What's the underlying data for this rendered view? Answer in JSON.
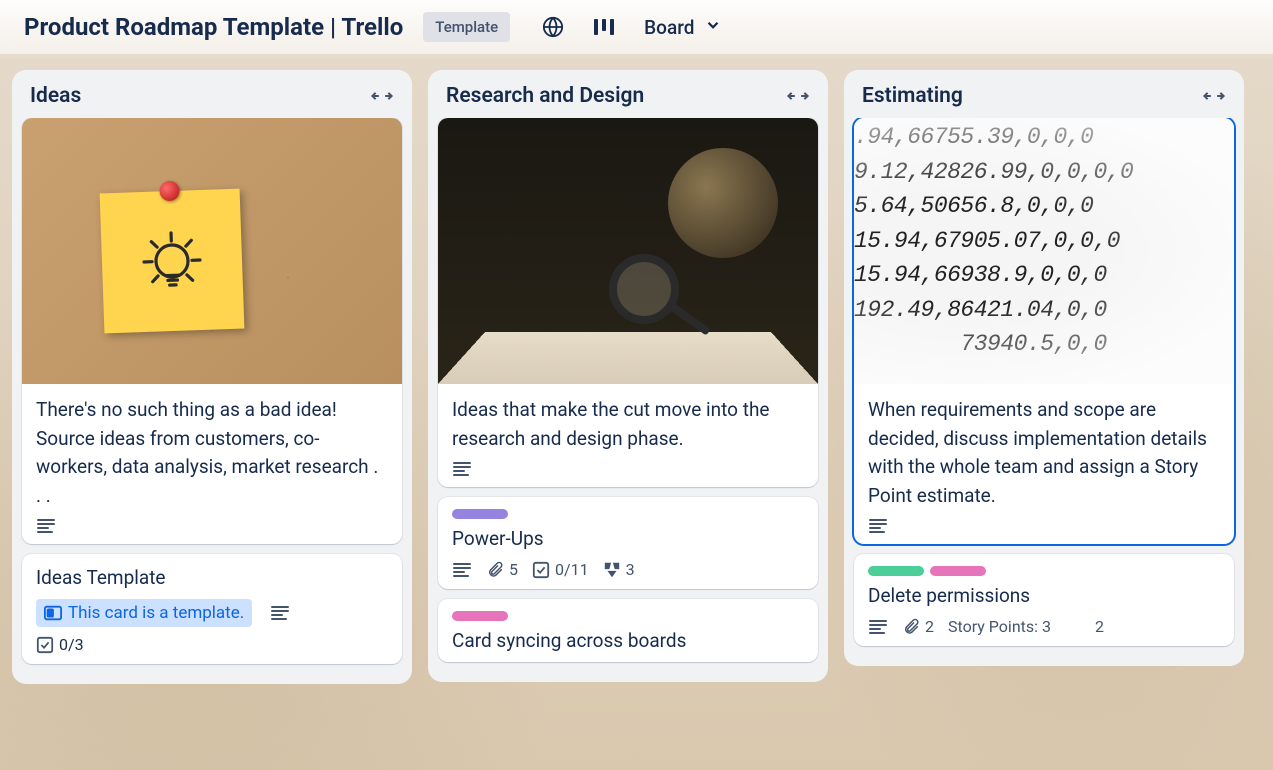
{
  "header": {
    "title": "Product Roadmap Template | Trello",
    "template_badge": "Template",
    "view_label": "Board"
  },
  "lists": [
    {
      "title": "Ideas",
      "cards": [
        {
          "text": "There's no such thing as a bad idea! Source ideas from customers, co-workers, data analysis, market research . . ."
        },
        {
          "title": "Ideas Template",
          "template_notice": "This card is a template.",
          "checklist": "0/3"
        }
      ]
    },
    {
      "title": "Research and Design",
      "cards": [
        {
          "text": "Ideas that make the cut move into the research and design phase."
        },
        {
          "title": "Power-Ups",
          "attachments": "5",
          "checklist": "0/11",
          "extra_count": "3"
        },
        {
          "title": "Card syncing across boards"
        }
      ]
    },
    {
      "title": "Estimating",
      "cover_numbers": ".94,66755.39,0,0,0\n9.12,42826.99,0,0,0,0\n5.64,50656.8,0,0,0\n15.94,67905.07,0,0,0\n15.94,66938.9,0,0,0\n192.49,86421.04,0,0\n        73940.5,0,0",
      "cards": [
        {
          "text": "When requirements and scope are decided, discuss implementation details with the whole team and assign a Story Point estimate."
        },
        {
          "title": "Delete permissions",
          "attachments": "2",
          "story_points_label": "Story Points: 3",
          "extra_count": "2"
        }
      ]
    }
  ]
}
